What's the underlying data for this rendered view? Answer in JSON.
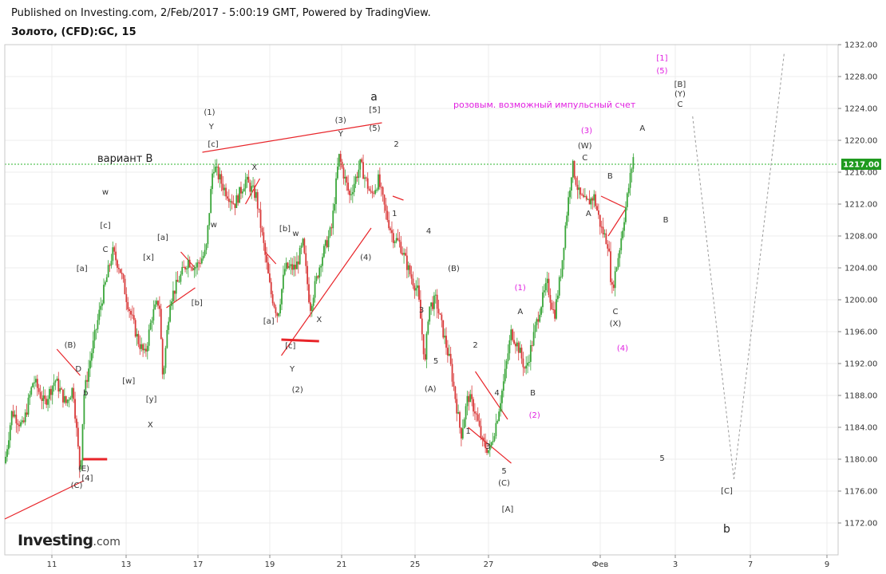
{
  "header": {
    "published": "Published on Investing.com, 2/Feb/2017 - 5:00:19 GMT, Powered by TradingView.",
    "symbol": "Золото, (CFD):GC, 15"
  },
  "logo": {
    "main": "Investing",
    "suffix": ".com"
  },
  "colors": {
    "up": "#3aa63a",
    "down": "#d93a3a",
    "price_line": "#2fb52f",
    "trendline": "#e8252a",
    "magenta": "#e01fe0",
    "projection": "#9a9a9a",
    "text": "#333333"
  },
  "chart_data": {
    "type": "candlestick",
    "timeframe": "15",
    "ylim": [
      1168,
      1232
    ],
    "y_ticks": [
      1172,
      1176,
      1180,
      1184,
      1188,
      1192,
      1196,
      1200,
      1204,
      1208,
      1212,
      1216,
      1220,
      1224,
      1228,
      1232
    ],
    "y_tick_labels": [
      "1172.00",
      "1176.00",
      "1180.00",
      "1184.00",
      "1188.00",
      "1192.00",
      "1196.00",
      "1200.00",
      "1204.00",
      "1208.00",
      "1212.00",
      "1216.00",
      "1220.00",
      "1224.00",
      "1228.00",
      "1232.00"
    ],
    "x_tick_labels": [
      "11",
      "13",
      "17",
      "19",
      "21",
      "25",
      "27",
      "Фев",
      "3",
      "7",
      "9"
    ],
    "current_price": 1217.0,
    "current_price_label": "1217.00",
    "grid": true,
    "price_path": [
      {
        "t": 0,
        "p": 1179.5
      },
      {
        "t": 2,
        "p": 1186
      },
      {
        "t": 5,
        "p": 1184
      },
      {
        "t": 8,
        "p": 1190
      },
      {
        "t": 11,
        "p": 1187
      },
      {
        "t": 14,
        "p": 1190
      },
      {
        "t": 17,
        "p": 1187
      },
      {
        "t": 19,
        "p": 1189
      },
      {
        "t": 21,
        "p": 1178
      },
      {
        "t": 22,
        "p": 1188
      },
      {
        "t": 24,
        "p": 1193
      },
      {
        "t": 27,
        "p": 1200
      },
      {
        "t": 30,
        "p": 1206
      },
      {
        "t": 32,
        "p": 1204
      },
      {
        "t": 34,
        "p": 1200
      },
      {
        "t": 37,
        "p": 1195
      },
      {
        "t": 39,
        "p": 1193
      },
      {
        "t": 41,
        "p": 1198
      },
      {
        "t": 43,
        "p": 1200
      },
      {
        "t": 44,
        "p": 1190
      },
      {
        "t": 46,
        "p": 1200
      },
      {
        "t": 49,
        "p": 1203
      },
      {
        "t": 51,
        "p": 1205
      },
      {
        "t": 53,
        "p": 1204
      },
      {
        "t": 56,
        "p": 1206
      },
      {
        "t": 58,
        "p": 1217
      },
      {
        "t": 61,
        "p": 1214
      },
      {
        "t": 64,
        "p": 1212
      },
      {
        "t": 67,
        "p": 1215
      },
      {
        "t": 70,
        "p": 1213
      },
      {
        "t": 72,
        "p": 1207
      },
      {
        "t": 74,
        "p": 1201
      },
      {
        "t": 76,
        "p": 1198
      },
      {
        "t": 78,
        "p": 1204
      },
      {
        "t": 81,
        "p": 1204
      },
      {
        "t": 83,
        "p": 1207
      },
      {
        "t": 85,
        "p": 1199
      },
      {
        "t": 88,
        "p": 1205
      },
      {
        "t": 91,
        "p": 1209
      },
      {
        "t": 93,
        "p": 1218
      },
      {
        "t": 96,
        "p": 1213
      },
      {
        "t": 99,
        "p": 1217
      },
      {
        "t": 102,
        "p": 1213
      },
      {
        "t": 104,
        "p": 1215
      },
      {
        "t": 106,
        "p": 1211
      },
      {
        "t": 108,
        "p": 1208
      },
      {
        "t": 110,
        "p": 1207
      },
      {
        "t": 113,
        "p": 1203
      },
      {
        "t": 115,
        "p": 1201
      },
      {
        "t": 117,
        "p": 1192
      },
      {
        "t": 118,
        "p": 1199
      },
      {
        "t": 120,
        "p": 1200
      },
      {
        "t": 122,
        "p": 1196
      },
      {
        "t": 124,
        "p": 1192
      },
      {
        "t": 127,
        "p": 1183
      },
      {
        "t": 129,
        "p": 1188
      },
      {
        "t": 131,
        "p": 1186
      },
      {
        "t": 133,
        "p": 1182
      },
      {
        "t": 135,
        "p": 1181
      },
      {
        "t": 137,
        "p": 1185
      },
      {
        "t": 139,
        "p": 1190
      },
      {
        "t": 141,
        "p": 1196
      },
      {
        "t": 143,
        "p": 1194
      },
      {
        "t": 145,
        "p": 1191
      },
      {
        "t": 147,
        "p": 1195
      },
      {
        "t": 149,
        "p": 1199
      },
      {
        "t": 151,
        "p": 1202
      },
      {
        "t": 153,
        "p": 1198
      },
      {
        "t": 155,
        "p": 1204
      },
      {
        "t": 156,
        "p": 1209
      },
      {
        "t": 158,
        "p": 1217
      },
      {
        "t": 160,
        "p": 1213
      },
      {
        "t": 162,
        "p": 1212
      },
      {
        "t": 164,
        "p": 1213
      },
      {
        "t": 166,
        "p": 1209
      },
      {
        "t": 168,
        "p": 1207
      },
      {
        "t": 169,
        "p": 1201
      },
      {
        "t": 171,
        "p": 1206
      },
      {
        "t": 173,
        "p": 1212
      },
      {
        "t": 175,
        "p": 1218
      }
    ]
  },
  "annotations": {
    "variant": "вариант B",
    "pink_note": "розовым. возможный импульсный счет",
    "labels": [
      {
        "text": "(B)",
        "t": 18.2,
        "p": 1194.0,
        "color": "text"
      },
      {
        "text": "D",
        "t": 20.5,
        "p": 1191.0,
        "color": "text"
      },
      {
        "text": "b",
        "t": 22.5,
        "p": 1188.0,
        "color": "text"
      },
      {
        "text": "(E)",
        "t": 22.0,
        "p": 1178.5,
        "color": "text"
      },
      {
        "text": "[4]",
        "t": 23.0,
        "p": 1177.3,
        "color": "text"
      },
      {
        "text": "(C)",
        "t": 20.0,
        "p": 1176.4,
        "color": "text"
      },
      {
        "text": "[a]",
        "t": 21.5,
        "p": 1203.6,
        "color": "text"
      },
      {
        "text": "C",
        "t": 28.0,
        "p": 1206.0,
        "color": "text"
      },
      {
        "text": "[c]",
        "t": 28.0,
        "p": 1209.0,
        "color": "text"
      },
      {
        "text": "w",
        "t": 28.0,
        "p": 1213.2,
        "color": "text"
      },
      {
        "text": "[w]",
        "t": 34.5,
        "p": 1189.5,
        "color": "text"
      },
      {
        "text": "[y]",
        "t": 40.8,
        "p": 1187.2,
        "color": "text"
      },
      {
        "text": "X",
        "t": 40.5,
        "p": 1184.0,
        "color": "text"
      },
      {
        "text": "[x]",
        "t": 40.0,
        "p": 1205.0,
        "color": "text"
      },
      {
        "text": "[a]",
        "t": 44.0,
        "p": 1207.5,
        "color": "text"
      },
      {
        "text": "[b]",
        "t": 53.5,
        "p": 1199.3,
        "color": "text"
      },
      {
        "text": "(1)",
        "t": 57.0,
        "p": 1223.2,
        "color": "text"
      },
      {
        "text": "Y",
        "t": 57.5,
        "p": 1221.4,
        "color": "text"
      },
      {
        "text": "[c]",
        "t": 58.0,
        "p": 1219.2,
        "color": "text"
      },
      {
        "text": "w",
        "t": 58.2,
        "p": 1209.1,
        "color": "text"
      },
      {
        "text": "X",
        "t": 69.5,
        "p": 1216.3,
        "color": "text"
      },
      {
        "text": "[b]",
        "t": 78.0,
        "p": 1208.6,
        "color": "text"
      },
      {
        "text": "w",
        "t": 81.0,
        "p": 1208.0,
        "color": "text"
      },
      {
        "text": "[a]",
        "t": 73.5,
        "p": 1197.0,
        "color": "text"
      },
      {
        "text": "[c]",
        "t": 79.5,
        "p": 1193.9,
        "color": "text"
      },
      {
        "text": "Y",
        "t": 80.0,
        "p": 1191.0,
        "color": "text"
      },
      {
        "text": "(2)",
        "t": 81.5,
        "p": 1188.4,
        "color": "text"
      },
      {
        "text": "X",
        "t": 87.5,
        "p": 1197.2,
        "color": "text"
      },
      {
        "text": "(3)",
        "t": 93.5,
        "p": 1222.2,
        "color": "text"
      },
      {
        "text": "Y",
        "t": 93.5,
        "p": 1220.5,
        "color": "text"
      },
      {
        "text": "(4)",
        "t": 100.5,
        "p": 1205.0,
        "color": "text"
      },
      {
        "text": "[5]",
        "t": 103.0,
        "p": 1223.5,
        "color": "text"
      },
      {
        "text": "(5)",
        "t": 103.0,
        "p": 1221.2,
        "color": "text"
      },
      {
        "text": "2",
        "t": 109.0,
        "p": 1219.2,
        "color": "text"
      },
      {
        "text": "1",
        "t": 108.5,
        "p": 1210.5,
        "color": "text"
      },
      {
        "text": "4",
        "t": 118.0,
        "p": 1208.3,
        "color": "text"
      },
      {
        "text": "3",
        "t": 116.0,
        "p": 1198.4,
        "color": "text"
      },
      {
        "text": "5",
        "t": 120.0,
        "p": 1192.0,
        "color": "text"
      },
      {
        "text": "(A)",
        "t": 118.5,
        "p": 1188.5,
        "color": "text"
      },
      {
        "text": "(B)",
        "t": 125.0,
        "p": 1203.6,
        "color": "text"
      },
      {
        "text": "2",
        "t": 131.0,
        "p": 1194.0,
        "color": "text"
      },
      {
        "text": "4",
        "t": 137.0,
        "p": 1188.0,
        "color": "text"
      },
      {
        "text": "1",
        "t": 129.0,
        "p": 1183.2,
        "color": "text"
      },
      {
        "text": "3",
        "t": 134.5,
        "p": 1181.3,
        "color": "text"
      },
      {
        "text": "5",
        "t": 139.0,
        "p": 1178.2,
        "color": "text"
      },
      {
        "text": "(C)",
        "t": 139.0,
        "p": 1176.7,
        "color": "text"
      },
      {
        "text": "[A]",
        "t": 140.0,
        "p": 1173.4,
        "color": "text"
      },
      {
        "text": "A",
        "t": 143.5,
        "p": 1198.2,
        "color": "text"
      },
      {
        "text": "B",
        "t": 147.0,
        "p": 1188.0,
        "color": "text"
      },
      {
        "text": "(W)",
        "t": 161.5,
        "p": 1219.0,
        "color": "text"
      },
      {
        "text": "C",
        "t": 161.5,
        "p": 1217.5,
        "color": "text"
      },
      {
        "text": "B",
        "t": 168.5,
        "p": 1215.2,
        "color": "text"
      },
      {
        "text": "A",
        "t": 162.5,
        "p": 1210.5,
        "color": "text"
      },
      {
        "text": "C",
        "t": 170.0,
        "p": 1198.2,
        "color": "text"
      },
      {
        "text": "(X)",
        "t": 170.0,
        "p": 1196.7,
        "color": "text"
      },
      {
        "text": "A",
        "t": 177.5,
        "p": 1221.2,
        "color": "text"
      },
      {
        "text": "B",
        "t": 184.0,
        "p": 1209.7,
        "color": "text"
      },
      {
        "text": "[B]",
        "t": 188.0,
        "p": 1226.7,
        "color": "text"
      },
      {
        "text": "(Y)",
        "t": 188.0,
        "p": 1225.5,
        "color": "text"
      },
      {
        "text": "C",
        "t": 188.0,
        "p": 1224.2,
        "color": "text"
      },
      {
        "text": "5",
        "t": 183.0,
        "p": 1179.8,
        "color": "text"
      },
      {
        "text": "[C]",
        "t": 201.0,
        "p": 1175.7,
        "color": "text"
      },
      {
        "text": "(1)",
        "t": 143.5,
        "p": 1201.2,
        "color": "magenta"
      },
      {
        "text": "(2)",
        "t": 147.5,
        "p": 1185.2,
        "color": "magenta"
      },
      {
        "text": "(3)",
        "t": 162.0,
        "p": 1220.9,
        "color": "magenta"
      },
      {
        "text": "(4)",
        "t": 172.0,
        "p": 1193.6,
        "color": "magenta"
      },
      {
        "text": "[1]",
        "t": 183.0,
        "p": 1230.0,
        "color": "magenta"
      },
      {
        "text": "(5)",
        "t": 183.0,
        "p": 1228.4,
        "color": "magenta"
      }
    ],
    "big_labels": [
      {
        "text": "a",
        "t": 102.8,
        "p": 1225.0
      },
      {
        "text": "b",
        "t": 201.0,
        "p": 1170.8
      }
    ]
  }
}
